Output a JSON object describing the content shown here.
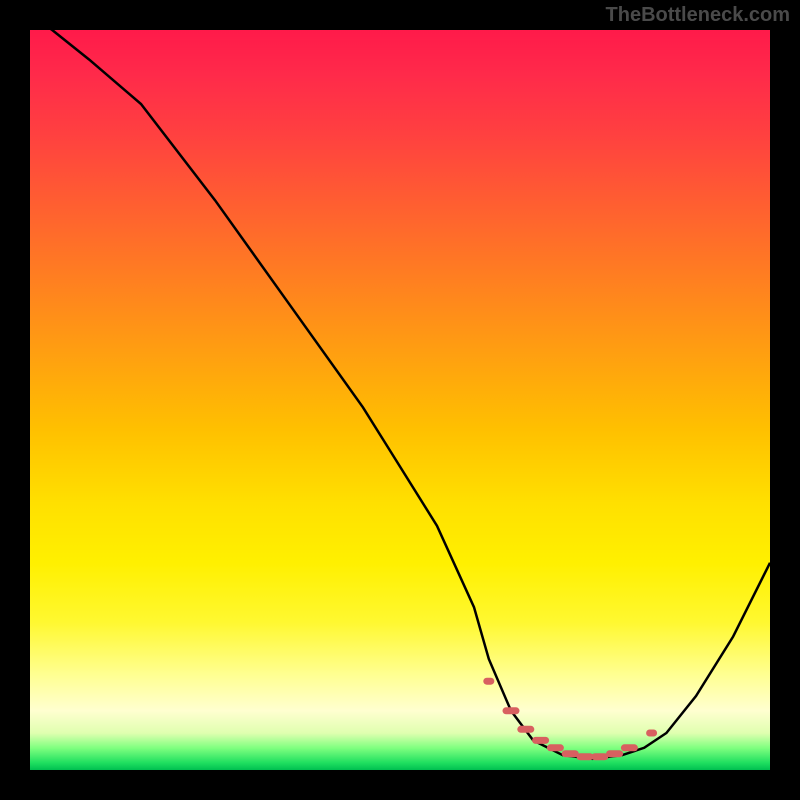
{
  "watermark": "TheBottleneck.com",
  "chart_data": {
    "type": "line",
    "title": "",
    "xlabel": "",
    "ylabel": "",
    "xlim": [
      0,
      100
    ],
    "ylim": [
      0,
      100
    ],
    "grid": false,
    "series": [
      {
        "name": "bottleneck-curve",
        "x": [
          0,
          3,
          8,
          15,
          25,
          35,
          45,
          55,
          60,
          62,
          65,
          68,
          72,
          76,
          80,
          83,
          86,
          90,
          95,
          100
        ],
        "y": [
          102,
          100,
          96,
          90,
          77,
          63,
          49,
          33,
          22,
          15,
          8,
          4,
          2,
          1.5,
          2,
          3,
          5,
          10,
          18,
          28
        ],
        "color": "#000000"
      },
      {
        "name": "optimal-markers",
        "type": "scatter-dashes",
        "x": [
          62,
          65,
          67,
          69,
          71,
          73,
          75,
          77,
          79,
          81,
          84
        ],
        "y": [
          12,
          8,
          5.5,
          4,
          3,
          2.2,
          1.8,
          1.8,
          2.2,
          3,
          5
        ],
        "color": "#d86060"
      }
    ],
    "note": "Bottleneck V-curve; y is a mismatch metric where low = green (good), high = red (bad). Optimal zone at x ≈ 62–86 where curve nears 0."
  }
}
